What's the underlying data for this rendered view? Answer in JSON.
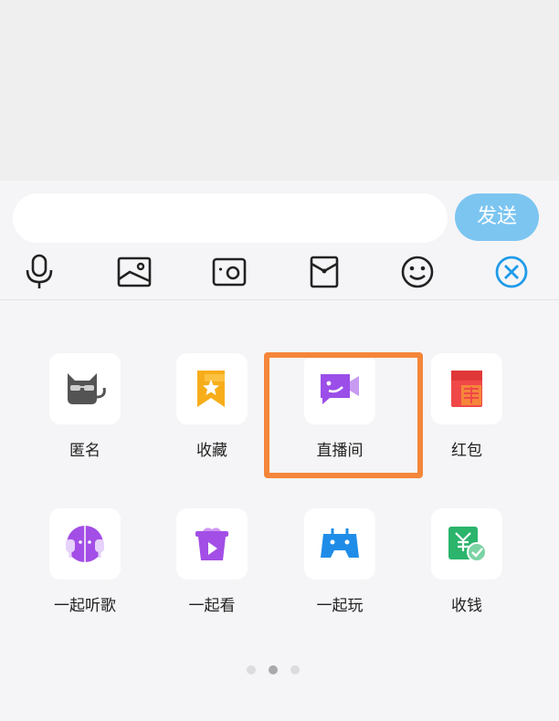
{
  "input": {
    "placeholder": "",
    "value": ""
  },
  "send_label": "发送",
  "toolbar": [
    {
      "name": "microphone-icon"
    },
    {
      "name": "image-icon"
    },
    {
      "name": "camera-icon"
    },
    {
      "name": "red-envelope-icon"
    },
    {
      "name": "emoji-icon"
    },
    {
      "name": "close-icon"
    }
  ],
  "apps": [
    {
      "label": "匿名",
      "icon": "anonymous-cat-icon"
    },
    {
      "label": "收藏",
      "icon": "favorites-bookmark-icon"
    },
    {
      "label": "直播间",
      "icon": "live-room-camera-icon"
    },
    {
      "label": "红包",
      "icon": "red-packet-icon"
    },
    {
      "label": "一起听歌",
      "icon": "listen-together-icon"
    },
    {
      "label": "一起看",
      "icon": "watch-together-icon"
    },
    {
      "label": "一起玩",
      "icon": "play-together-gamepad-icon"
    },
    {
      "label": "收钱",
      "icon": "receive-money-icon"
    }
  ],
  "pager": {
    "pages": 3,
    "active": 2
  },
  "colors": {
    "send_button": "#7cc5f1",
    "highlight": "#f5863a",
    "close_icon": "#1e9be9"
  }
}
